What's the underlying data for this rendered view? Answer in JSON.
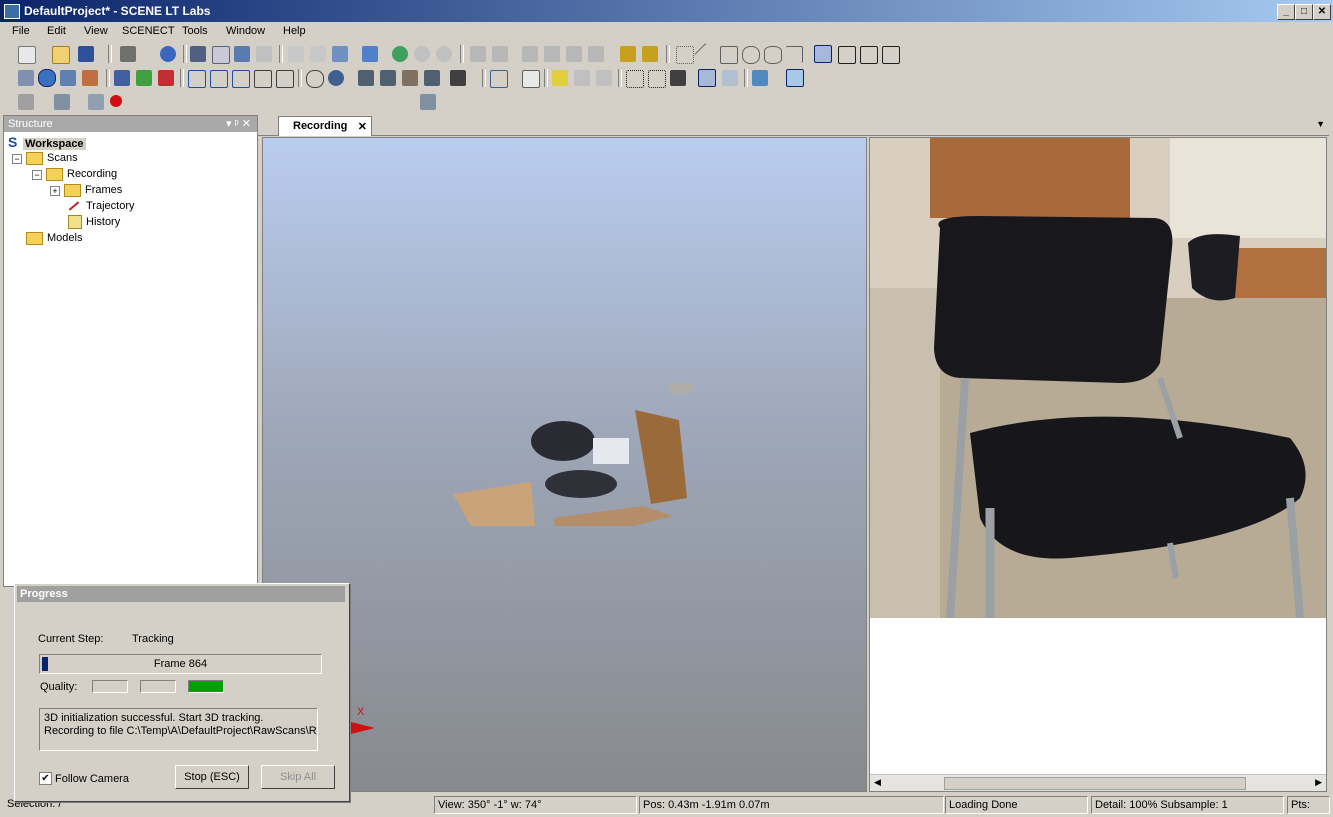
{
  "window": {
    "title": "DefaultProject* - SCENE LT Labs",
    "min_label": "_",
    "max_label": "□",
    "close_label": "✕"
  },
  "menu": [
    "File",
    "Edit",
    "View",
    "SCENECT",
    "Tools",
    "Window",
    "Help"
  ],
  "structure_panel": {
    "title": "Structure",
    "pin_label": "▾ ᵖ ✕",
    "tree": {
      "workspace": "Workspace",
      "scans": "Scans",
      "recording": "Recording",
      "frames": "Frames",
      "trajectory": "Trajectory",
      "history": "History",
      "models": "Models"
    }
  },
  "tabs": {
    "active": "Recording",
    "close": "✕",
    "dropdown": "▼"
  },
  "axis_label": "X",
  "progress_dialog": {
    "title": "Progress",
    "current_step_label": "Current Step:",
    "current_step_value": "Tracking",
    "bar_text": "Frame 864",
    "bar_fraction": 0.02,
    "quality_label": "Quality:",
    "quality_level": 3,
    "message_lines": [
      "3D initialization successful. Start 3D tracking.",
      "Recording to file C:\\Temp\\A\\DefaultProject\\RawScans\\R"
    ],
    "follow_camera_label": "Follow Camera",
    "follow_camera_checked": "✔",
    "stop_button": "Stop (ESC)",
    "skip_button": "Skip All"
  },
  "status_bar": {
    "selection": "Selection: /",
    "view": "View: 350° -1° w: 74°",
    "pos": "Pos: 0.43m -1.91m 0.07m",
    "state": "Loading Done",
    "detail": "Detail: 100%  Subsample:  1",
    "pts": "Pts:"
  },
  "colors": {
    "accent": "#0a246a",
    "quality_good": "#00a000",
    "panel_header": "#a9a9a9"
  }
}
